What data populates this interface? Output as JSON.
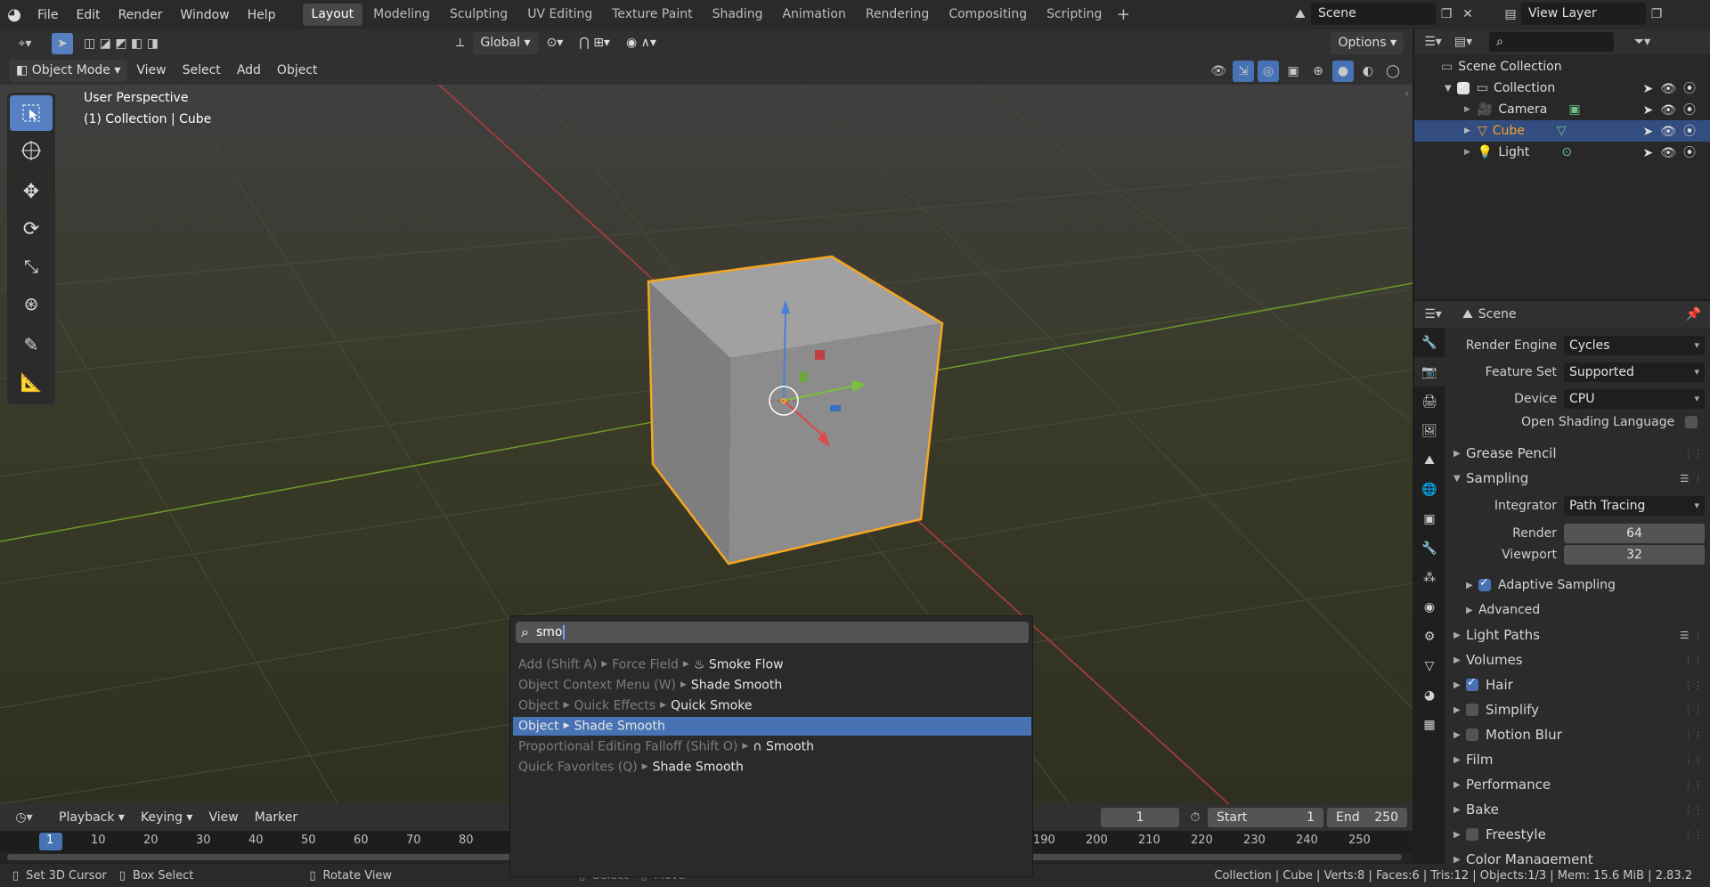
{
  "topbar": {
    "menus": [
      "File",
      "Edit",
      "Render",
      "Window",
      "Help"
    ],
    "workspaces": [
      "Layout",
      "Modeling",
      "Sculpting",
      "UV Editing",
      "Texture Paint",
      "Shading",
      "Animation",
      "Rendering",
      "Compositing",
      "Scripting"
    ],
    "active_workspace": "Layout",
    "scene": "Scene",
    "view_layer": "View Layer"
  },
  "viewport_header": {
    "transform_orientation": "Global",
    "options": "Options",
    "mode": "Object Mode",
    "menus": [
      "View",
      "Select",
      "Add",
      "Object"
    ]
  },
  "viewport": {
    "perspective": "User Perspective",
    "collection_info": "(1) Collection | Cube"
  },
  "outliner": {
    "root": "Scene Collection",
    "collection": "Collection",
    "items": [
      "Camera",
      "Cube",
      "Light"
    ],
    "selected": "Cube"
  },
  "properties": {
    "context": "Scene",
    "render_engine_label": "Render Engine",
    "render_engine": "Cycles",
    "feature_set_label": "Feature Set",
    "feature_set": "Supported",
    "device_label": "Device",
    "device": "CPU",
    "osl_label": "Open Shading Language",
    "sections": {
      "grease_pencil": "Grease Pencil",
      "sampling": "Sampling",
      "light_paths": "Light Paths",
      "volumes": "Volumes",
      "hair": "Hair",
      "simplify": "Simplify",
      "motion_blur": "Motion Blur",
      "film": "Film",
      "performance": "Performance",
      "bake": "Bake",
      "freestyle": "Freestyle",
      "color_management": "Color Management"
    },
    "integrator_label": "Integrator",
    "integrator": "Path Tracing",
    "render_label": "Render",
    "render_samples": "64",
    "viewport_label": "Viewport",
    "viewport_samples": "32",
    "adaptive_sampling": "Adaptive Sampling",
    "advanced": "Advanced"
  },
  "search": {
    "query": "smo",
    "results": [
      {
        "path": [
          "Add (Shift A)",
          "Force Field"
        ],
        "item": "Smoke Flow"
      },
      {
        "path": [
          "Object Context Menu (W)"
        ],
        "item": "Shade Smooth"
      },
      {
        "path": [
          "Object",
          "Quick Effects"
        ],
        "item": "Quick Smoke"
      },
      {
        "path": [
          "Object"
        ],
        "item": "Shade Smooth"
      },
      {
        "path": [
          "Proportional Editing Falloff (Shift O)"
        ],
        "item": "Smooth"
      },
      {
        "path": [
          "Quick Favorites (Q)"
        ],
        "item": "Shade Smooth"
      }
    ]
  },
  "timeline": {
    "menus": [
      "Playback",
      "Keying",
      "View",
      "Marker"
    ],
    "current_frame": "1",
    "start_label": "Start",
    "start": "1",
    "end_label": "End",
    "end": "250",
    "ticks": [
      "1",
      "10",
      "20",
      "30",
      "40",
      "50",
      "60",
      "70",
      "80",
      "190",
      "200",
      "210",
      "220",
      "230",
      "240",
      "250"
    ]
  },
  "statusbar": {
    "set_cursor": "Set 3D Cursor",
    "box_select": "Box Select",
    "rotate_view": "Rotate View",
    "select": "Select",
    "move": "Move",
    "stats": "Collection | Cube | Verts:8 | Faces:6 | Tris:12 | Objects:1/3 | Mem: 15.6 MiB | 2.83.2"
  },
  "colors": {
    "accent": "#4772b3",
    "selection_outline": "#f5a623",
    "x_axis": "#b63c3c",
    "y_axis": "#6d9a2a"
  }
}
